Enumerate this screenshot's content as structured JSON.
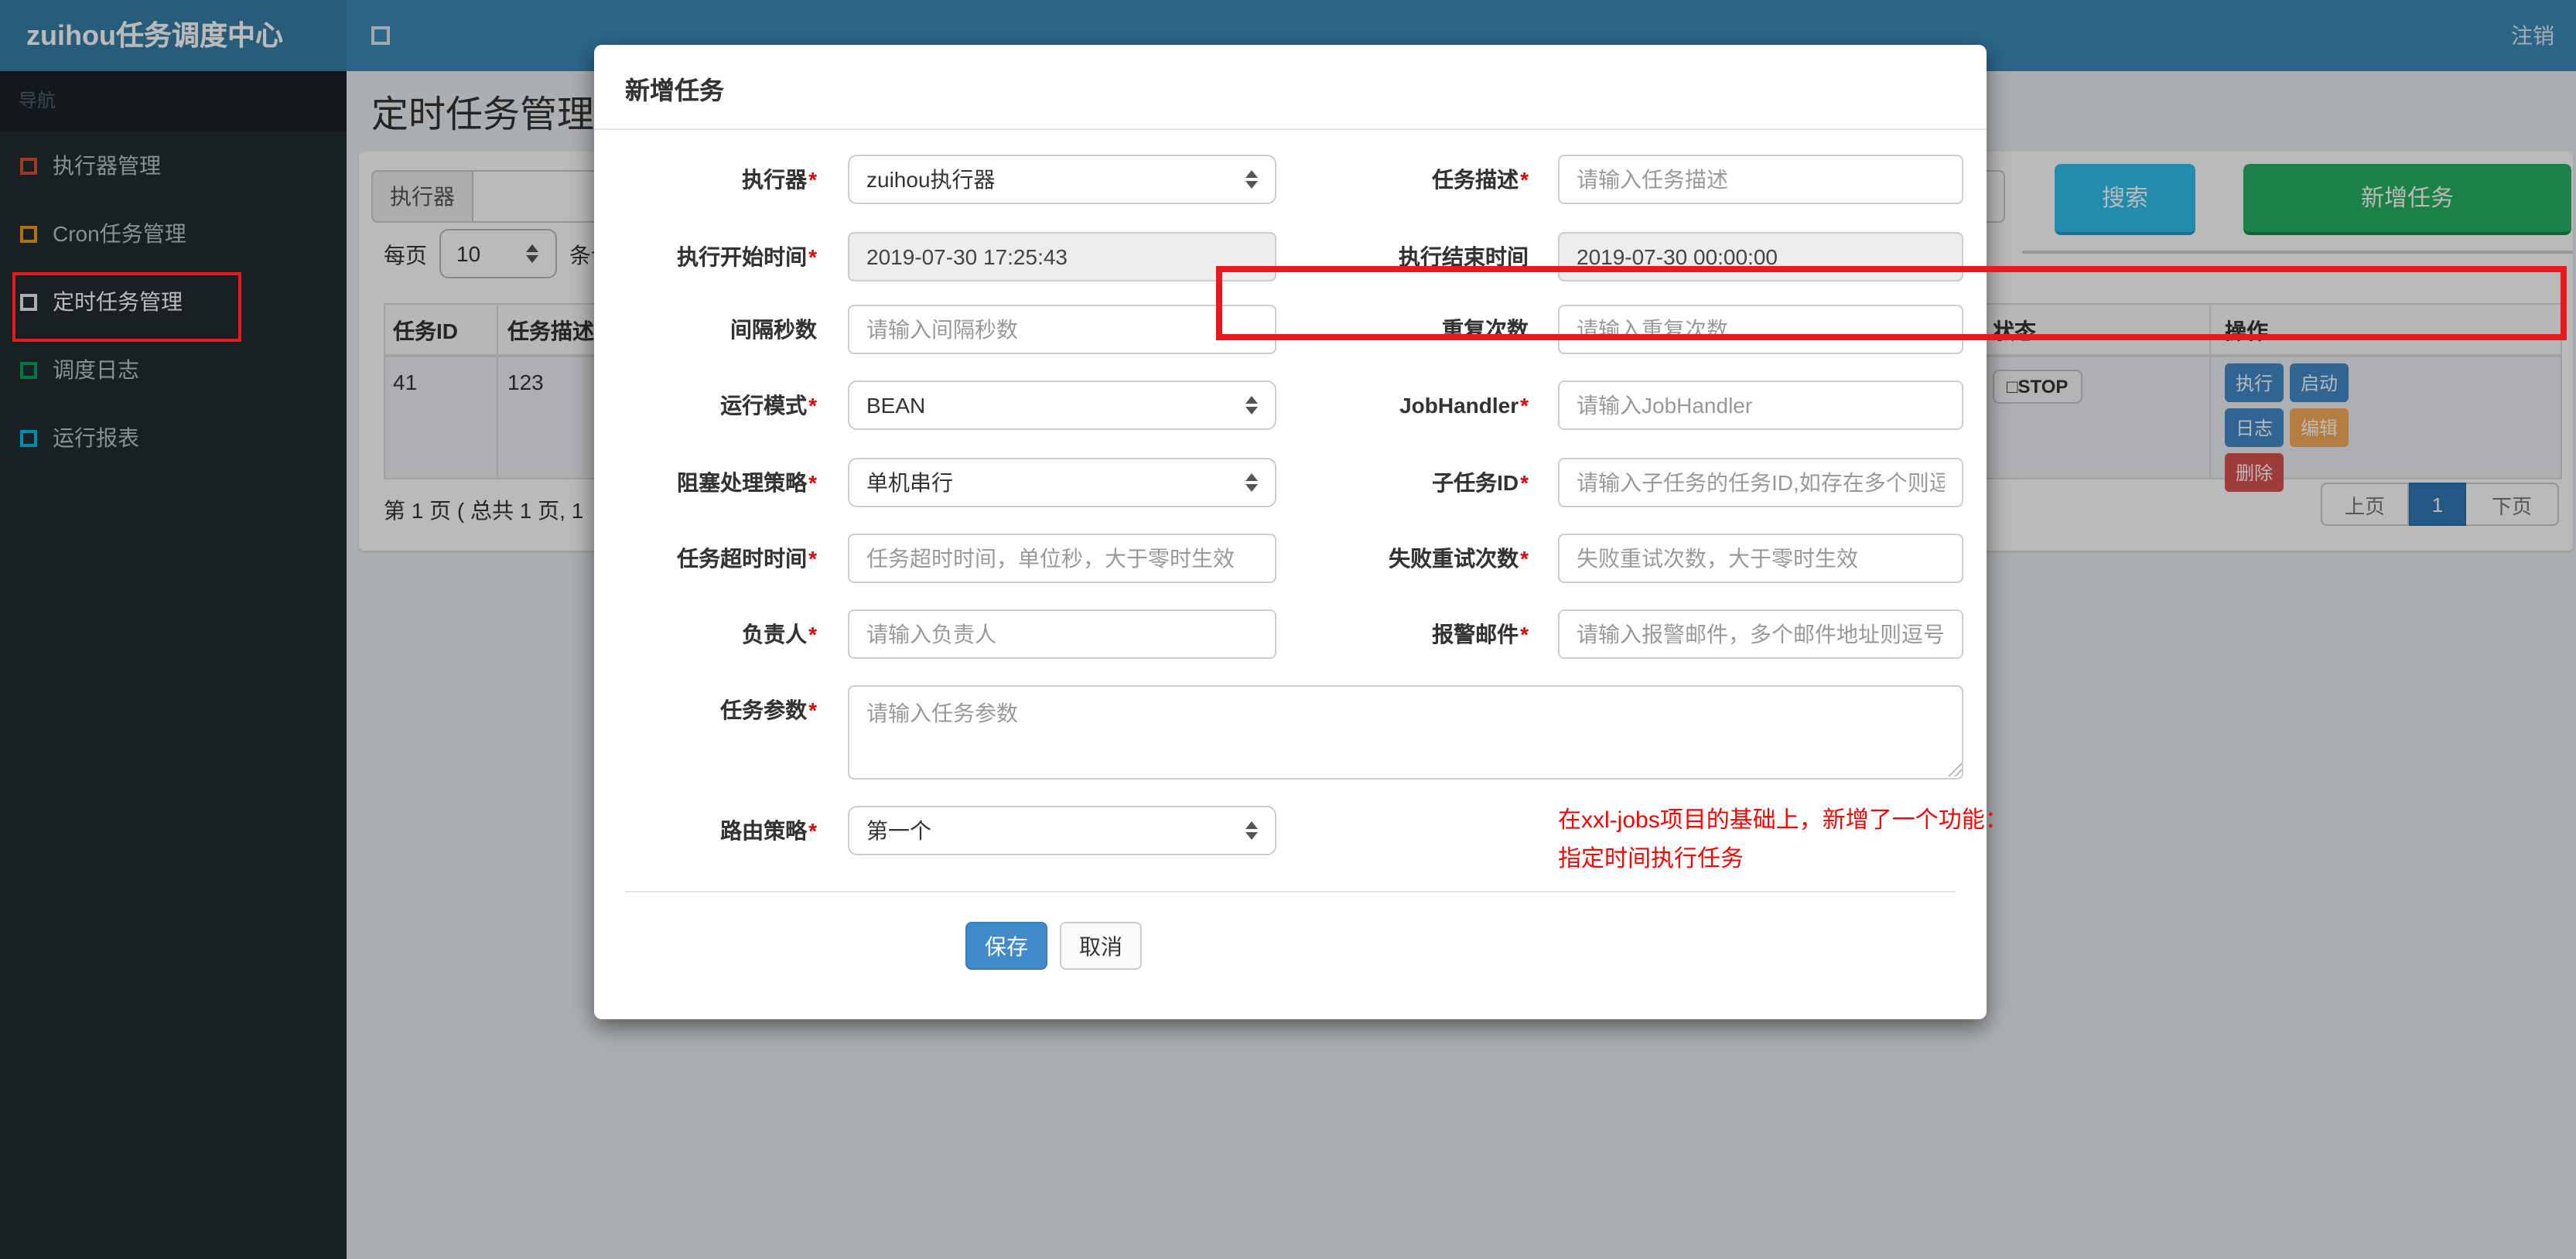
{
  "colors": {
    "navbar": "#3c8dbc",
    "logo_bg": "#367fa9",
    "sidebar": "#222d32",
    "search_button": "#31c0ee",
    "add_button": "#27b161",
    "save_button": "#428bca",
    "pagination_active": "#337ab7",
    "annotation_red": "#e8191d",
    "note_red": "#fe0100"
  },
  "navbar": {
    "brand": "zuihou任务调度中心",
    "logout": "注销"
  },
  "sidebar": {
    "section_label": "导航",
    "items": [
      {
        "label": "执行器管理",
        "icon": "square-outline-icon",
        "color": "#dd4b39",
        "active": false
      },
      {
        "label": "Cron任务管理",
        "icon": "square-outline-icon",
        "color": "#f39c12",
        "active": false
      },
      {
        "label": "定时任务管理",
        "icon": "square-outline-icon",
        "color": "#eeeeee",
        "active": true
      },
      {
        "label": "调度日志",
        "icon": "square-outline-icon",
        "color": "#00a65a",
        "active": false
      },
      {
        "label": "运行报表",
        "icon": "square-outline-icon",
        "color": "#00c0ef",
        "active": false
      }
    ]
  },
  "page": {
    "title": "定时任务管理",
    "filter": {
      "executor_label": "执行器",
      "search_button": "搜索",
      "add_button": "新增任务"
    },
    "perpage": {
      "prefix": "每页",
      "value": "10",
      "suffix": "条记录"
    },
    "table": {
      "headers": [
        "任务ID",
        "任务描述",
        "状态",
        "操作"
      ],
      "row": {
        "id": "41",
        "desc": "123",
        "status_icon": "□",
        "status_label": "STOP",
        "actions": [
          {
            "label": "执行",
            "color": "#428bca"
          },
          {
            "label": "启动",
            "color": "#428bca"
          },
          {
            "label": "日志",
            "color": "#428bca"
          },
          {
            "label": "编辑",
            "color": "#f8ac59"
          },
          {
            "label": "删除",
            "color": "#d9534f"
          }
        ]
      }
    },
    "pagination": {
      "summary": "第 1 页 ( 总共 1 页, 1",
      "prev": "上页",
      "current": "1",
      "next": "下页"
    }
  },
  "modal": {
    "title": "新增任务",
    "required_marker": "*",
    "form": {
      "executor": {
        "label": "执行器",
        "required": true,
        "value": "zuihou执行器"
      },
      "job_desc": {
        "label": "任务描述",
        "required": true,
        "placeholder": "请输入任务描述"
      },
      "start_time": {
        "label": "执行开始时间",
        "required": true,
        "value": "2019-07-30 17:25:43"
      },
      "end_time": {
        "label": "执行结束时间",
        "required": false,
        "value": "2019-07-30 00:00:00"
      },
      "interval": {
        "label": "间隔秒数",
        "required": false,
        "placeholder": "请输入间隔秒数"
      },
      "repeat_count": {
        "label": "重复次数",
        "required": false,
        "placeholder": "请输入重复次数"
      },
      "glue_type": {
        "label": "运行模式",
        "required": true,
        "value": "BEAN"
      },
      "job_handler": {
        "label": "JobHandler",
        "required": true,
        "placeholder": "请输入JobHandler"
      },
      "block_strategy": {
        "label": "阻塞处理策略",
        "required": true,
        "value": "单机串行"
      },
      "child_job_id": {
        "label": "子任务ID",
        "required": true,
        "placeholder": "请输入子任务的任务ID,如存在多个则逗号分隔"
      },
      "timeout": {
        "label": "任务超时时间",
        "required": true,
        "placeholder": "任务超时时间，单位秒，大于零时生效"
      },
      "fail_retry": {
        "label": "失败重试次数",
        "required": true,
        "placeholder": "失败重试次数，大于零时生效"
      },
      "author": {
        "label": "负责人",
        "required": true,
        "placeholder": "请输入负责人"
      },
      "alarm_email": {
        "label": "报警邮件",
        "required": true,
        "placeholder": "请输入报警邮件，多个邮件地址则逗号分隔"
      },
      "job_param": {
        "label": "任务参数",
        "required": true,
        "placeholder": "请输入任务参数"
      },
      "route_strategy": {
        "label": "路由策略",
        "required": true,
        "value": "第一个"
      }
    },
    "note": {
      "line1": "在xxl-jobs项目的基础上，新增了一个功能：",
      "line2": "指定时间执行任务"
    },
    "save_button": "保存",
    "cancel_button": "取消"
  }
}
